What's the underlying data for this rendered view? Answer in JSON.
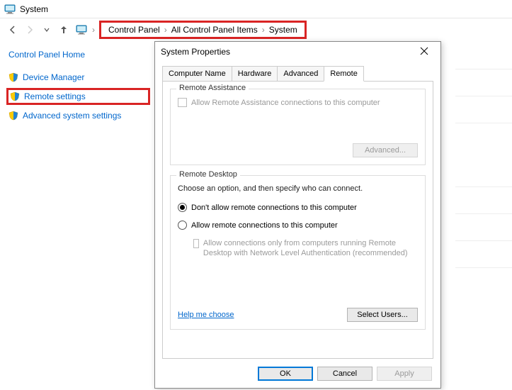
{
  "window": {
    "title": "System"
  },
  "breadcrumb": {
    "a": "Control Panel",
    "b": "All Control Panel Items",
    "c": "System"
  },
  "leftnav": {
    "home": "Control Panel Home",
    "devmgr": "Device Manager",
    "remote": "Remote settings",
    "advsys": "Advanced system settings"
  },
  "dialog": {
    "title": "System Properties",
    "tabs": {
      "cn": "Computer Name",
      "hw": "Hardware",
      "adv": "Advanced",
      "rm": "Remote"
    },
    "ra": {
      "legend": "Remote Assistance",
      "allow": "Allow Remote Assistance connections to this computer",
      "advbtn": "Advanced..."
    },
    "rd": {
      "legend": "Remote Desktop",
      "desc": "Choose an option, and then specify who can connect.",
      "opt1": "Don't allow remote connections to this computer",
      "opt2": "Allow remote connections to this computer",
      "nla": "Allow connections only from computers running Remote Desktop with Network Level Authentication (recommended)",
      "help": "Help me choose",
      "selusers": "Select Users..."
    },
    "buttons": {
      "ok": "OK",
      "cancel": "Cancel",
      "apply": "Apply"
    }
  }
}
